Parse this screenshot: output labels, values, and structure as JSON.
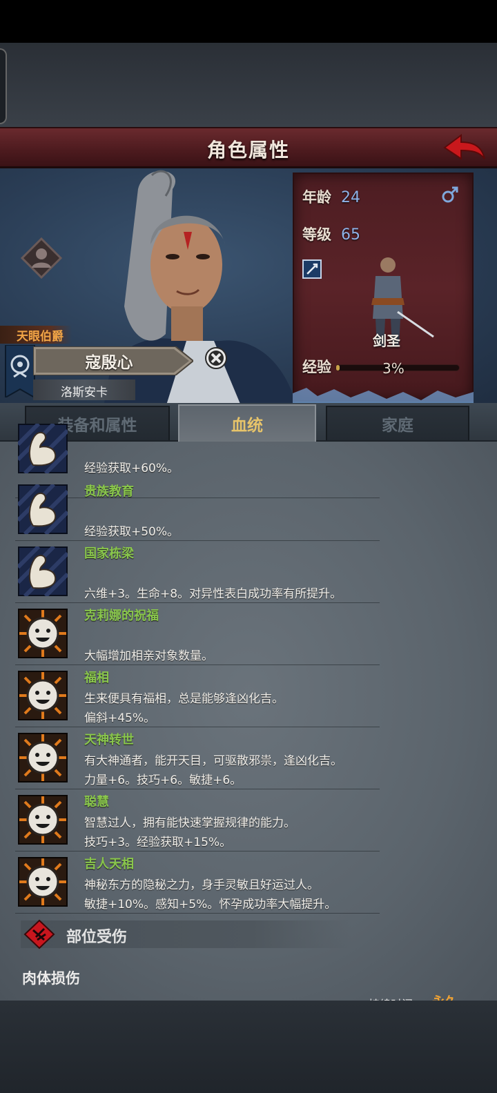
{
  "header": {
    "title": "角色属性"
  },
  "character": {
    "title_tag": "天眼伯爵",
    "name": "寇殷心",
    "region": "洛斯安卡"
  },
  "stats": {
    "age_label": "年龄",
    "age_value": "24",
    "level_label": "等级",
    "level_value": "65",
    "class_name": "剑圣",
    "exp_label": "经验",
    "exp_percent": "3%",
    "exp_fraction": 0.03
  },
  "tabs": [
    {
      "label": "装备和属性",
      "active": false
    },
    {
      "label": "血统",
      "active": true
    },
    {
      "label": "家庭",
      "active": false
    }
  ],
  "traits": [
    {
      "icon": "flexed-arm-icon",
      "name": "",
      "lines": [
        "经验获取+60%。"
      ]
    },
    {
      "icon": "flexed-arm-icon",
      "name": "贵族教育",
      "lines": [
        "",
        "经验获取+50%。"
      ]
    },
    {
      "icon": "flexed-arm-icon",
      "name": "国家栋梁",
      "lines": [
        "",
        "六维+3。生命+8。对异性表白成功率有所提升。"
      ]
    },
    {
      "icon": "smiley-face-icon",
      "name": "克莉娜的祝福",
      "lines": [
        "",
        "大幅增加相亲对象数量。"
      ]
    },
    {
      "icon": "smiley-face-icon",
      "name": "福相",
      "lines": [
        "生来便具有福相，总是能够逢凶化吉。",
        "偏斜+45%。"
      ]
    },
    {
      "icon": "smiley-face-icon",
      "name": "天神转世",
      "lines": [
        "有大神通者，能开天目，可驱散邪祟，逢凶化吉。",
        "力量+6。技巧+6。敏捷+6。"
      ]
    },
    {
      "icon": "smiley-face-icon",
      "name": "聪慧",
      "lines": [
        "智慧过人，拥有能快速掌握规律的能力。",
        "技巧+3。经验获取+15%。"
      ]
    },
    {
      "icon": "smiley-face-icon",
      "name": "吉人天相",
      "lines": [
        "神秘东方的隐秘之力，身手灵敏且好运过人。",
        "敏捷+10%。感知+5%。怀孕成功率大幅提升。"
      ]
    }
  ],
  "injury": {
    "section_label": "部位受伤",
    "category": "肉体损伤",
    "duration_label": "持续时间",
    "duration_value": "永久"
  },
  "colors": {
    "title_bar": "#5a2226",
    "trait_name": "#89c64c",
    "active_tab_text": "#e7c46a",
    "stat_value": "#8fb3e8"
  }
}
